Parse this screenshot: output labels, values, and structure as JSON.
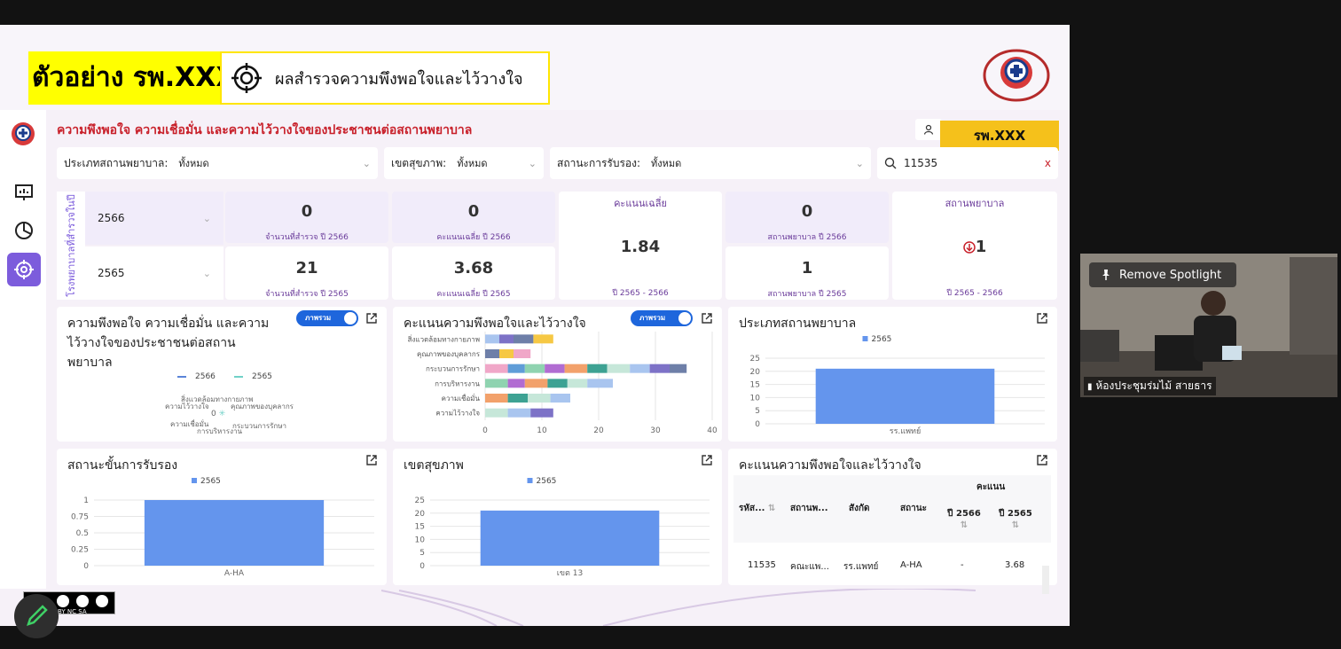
{
  "header": {
    "title": "ตัวอย่าง รพ.XXX",
    "subtitle": "ผลสำรวจความพึงพอใจและไว้วางใจ"
  },
  "dashboard": {
    "page_title": "ความพึงพอใจ ความเชื่อมั่น และความไว้วางใจของประชาชนต่อสถานพยาบาล",
    "hospital_button": "รพ.XXX"
  },
  "filters": {
    "type_label": "ประเภทสถานพยาบาล:",
    "type_value": "ทั้งหมด",
    "region_label": "เขตสุขภาพ:",
    "region_value": "ทั้งหมด",
    "accr_label": "สถานะการรับรอง:",
    "accr_value": "ทั้งหมด",
    "search_value": "11535",
    "search_clear": "x"
  },
  "kpi": {
    "vertical_label": "โรงพยาบาลที่สำรวจในปี",
    "year_top": "2566",
    "year_bottom": "2565",
    "surveyed_2566": "0",
    "surveyed_2566_cap": "จำนวนที่สำรวจ ปี 2566",
    "avg_2566": "0",
    "avg_2566_cap": "คะแนนเฉลี่ย ปี 2566",
    "avg_head": "คะแนนเฉลี่ย",
    "avg_change": "1.84",
    "avg_change_cap": "ปี 2565 - 2566",
    "hosp_2566": "0",
    "hosp_2566_cap": "สถานพยาบาล ปี 2566",
    "hosp_head": "สถานพยาบาล",
    "hosp_change": "1",
    "hosp_change_cap": "ปี 2565 - 2566",
    "surveyed_2565": "21",
    "surveyed_2565_cap": "จำนวนที่สำรวจ ปี 2565",
    "avg_2565": "3.68",
    "avg_2565_cap": "คะแนนเฉลี่ย ปี 2565",
    "hosp_2565": "1",
    "hosp_2565_cap": "สถานพยาบาล ปี 2565"
  },
  "panels": {
    "radar_title": "ความพึงพอใจ ความเชื่อมั่น และความไว้วางใจของประชาชนต่อสถานพยาบาล",
    "radar_toggle": "ภาพรวม",
    "bars_title": "คะแนนความพึงพอใจและไว้วางใจ",
    "bars_toggle": "ภาพรวม",
    "type_title": "ประเภทสถานพยาบาล",
    "accr_title": "สถานะขั้นการรับรอง",
    "region_title": "เขตสุขภาพ",
    "table_title": "คะแนนความพึงพอใจและไว้วางใจ"
  },
  "chart_data": [
    {
      "type": "radar",
      "legend": [
        "2566",
        "2565"
      ],
      "axes": [
        "สิ่งแวดล้อมทางกายภาพ",
        "คุณภาพของบุคลากร",
        "กระบวนการรักษา",
        "การบริหารงาน",
        "ความเชื่อมั่น",
        "ความไว้วางใจ"
      ],
      "center_label": "0"
    },
    {
      "type": "bar",
      "orientation": "horizontal-stacked",
      "categories": [
        "สิ่งแวดล้อมทางกายภาพ",
        "คุณภาพของบุคลากร",
        "กระบวนการรักษา",
        "การบริหารงาน",
        "ความเชื่อมั่น",
        "ความไว้วางใจ"
      ],
      "segments": [
        [
          2.5,
          2.5,
          3.5,
          3.5
        ],
        [
          2.5,
          2.5,
          3
        ],
        [
          4,
          3,
          3.5,
          3.5,
          4,
          3.5,
          4,
          3.5,
          3.5,
          3
        ],
        [
          4,
          3,
          4,
          3.5,
          3.5,
          4.5
        ],
        [
          4,
          3.5,
          4,
          3.5
        ],
        [
          4,
          4,
          4
        ]
      ],
      "colors": [
        "#a9c5ef",
        "#7d72c7",
        "#6e7fa8",
        "#f6c844",
        "#f0a7c8",
        "#5f9dd8",
        "#8fd3b0",
        "#b16cd2",
        "#f2a16b",
        "#3da293",
        "#c6e7d9"
      ],
      "xticks": [
        "0",
        "10",
        "20",
        "30",
        "40"
      ],
      "xlim": [
        0,
        40
      ]
    },
    {
      "type": "bar",
      "categories": [
        "รร.แพทย์"
      ],
      "series": [
        {
          "name": "2565",
          "values": [
            21
          ]
        }
      ],
      "yticks": [
        "0",
        "5",
        "10",
        "15",
        "20",
        "25"
      ],
      "ylim": [
        0,
        25
      ]
    },
    {
      "type": "bar",
      "categories": [
        "A-HA"
      ],
      "series": [
        {
          "name": "2565",
          "values": [
            1
          ]
        }
      ],
      "yticks": [
        "0",
        "0.25",
        "0.5",
        "0.75",
        "1"
      ],
      "ylim": [
        0,
        1
      ]
    },
    {
      "type": "bar",
      "categories": [
        "เขต 13"
      ],
      "series": [
        {
          "name": "2565",
          "values": [
            21
          ]
        }
      ],
      "yticks": [
        "0",
        "5",
        "10",
        "15",
        "20",
        "25"
      ],
      "ylim": [
        0,
        25
      ]
    }
  ],
  "table": {
    "group_header": "คะแนน",
    "columns": [
      "รหัส...",
      "สถานพ...",
      "สังกัด",
      "สถานะ",
      "ปี 2566",
      "ปี 2565"
    ],
    "rows": [
      [
        "11535",
        "คณะแพ...",
        "รร.แพทย์",
        "A-HA",
        "-",
        "3.68"
      ]
    ]
  },
  "video": {
    "spotlight_label": "Remove Spotlight",
    "participant": "ห้องประชุมร่มไม้ สายธาร"
  },
  "colors": {
    "accent": "#7c5cdc",
    "bar": "#6495ed",
    "brand_red": "#c8202a",
    "yellow": "#f5c11b"
  }
}
